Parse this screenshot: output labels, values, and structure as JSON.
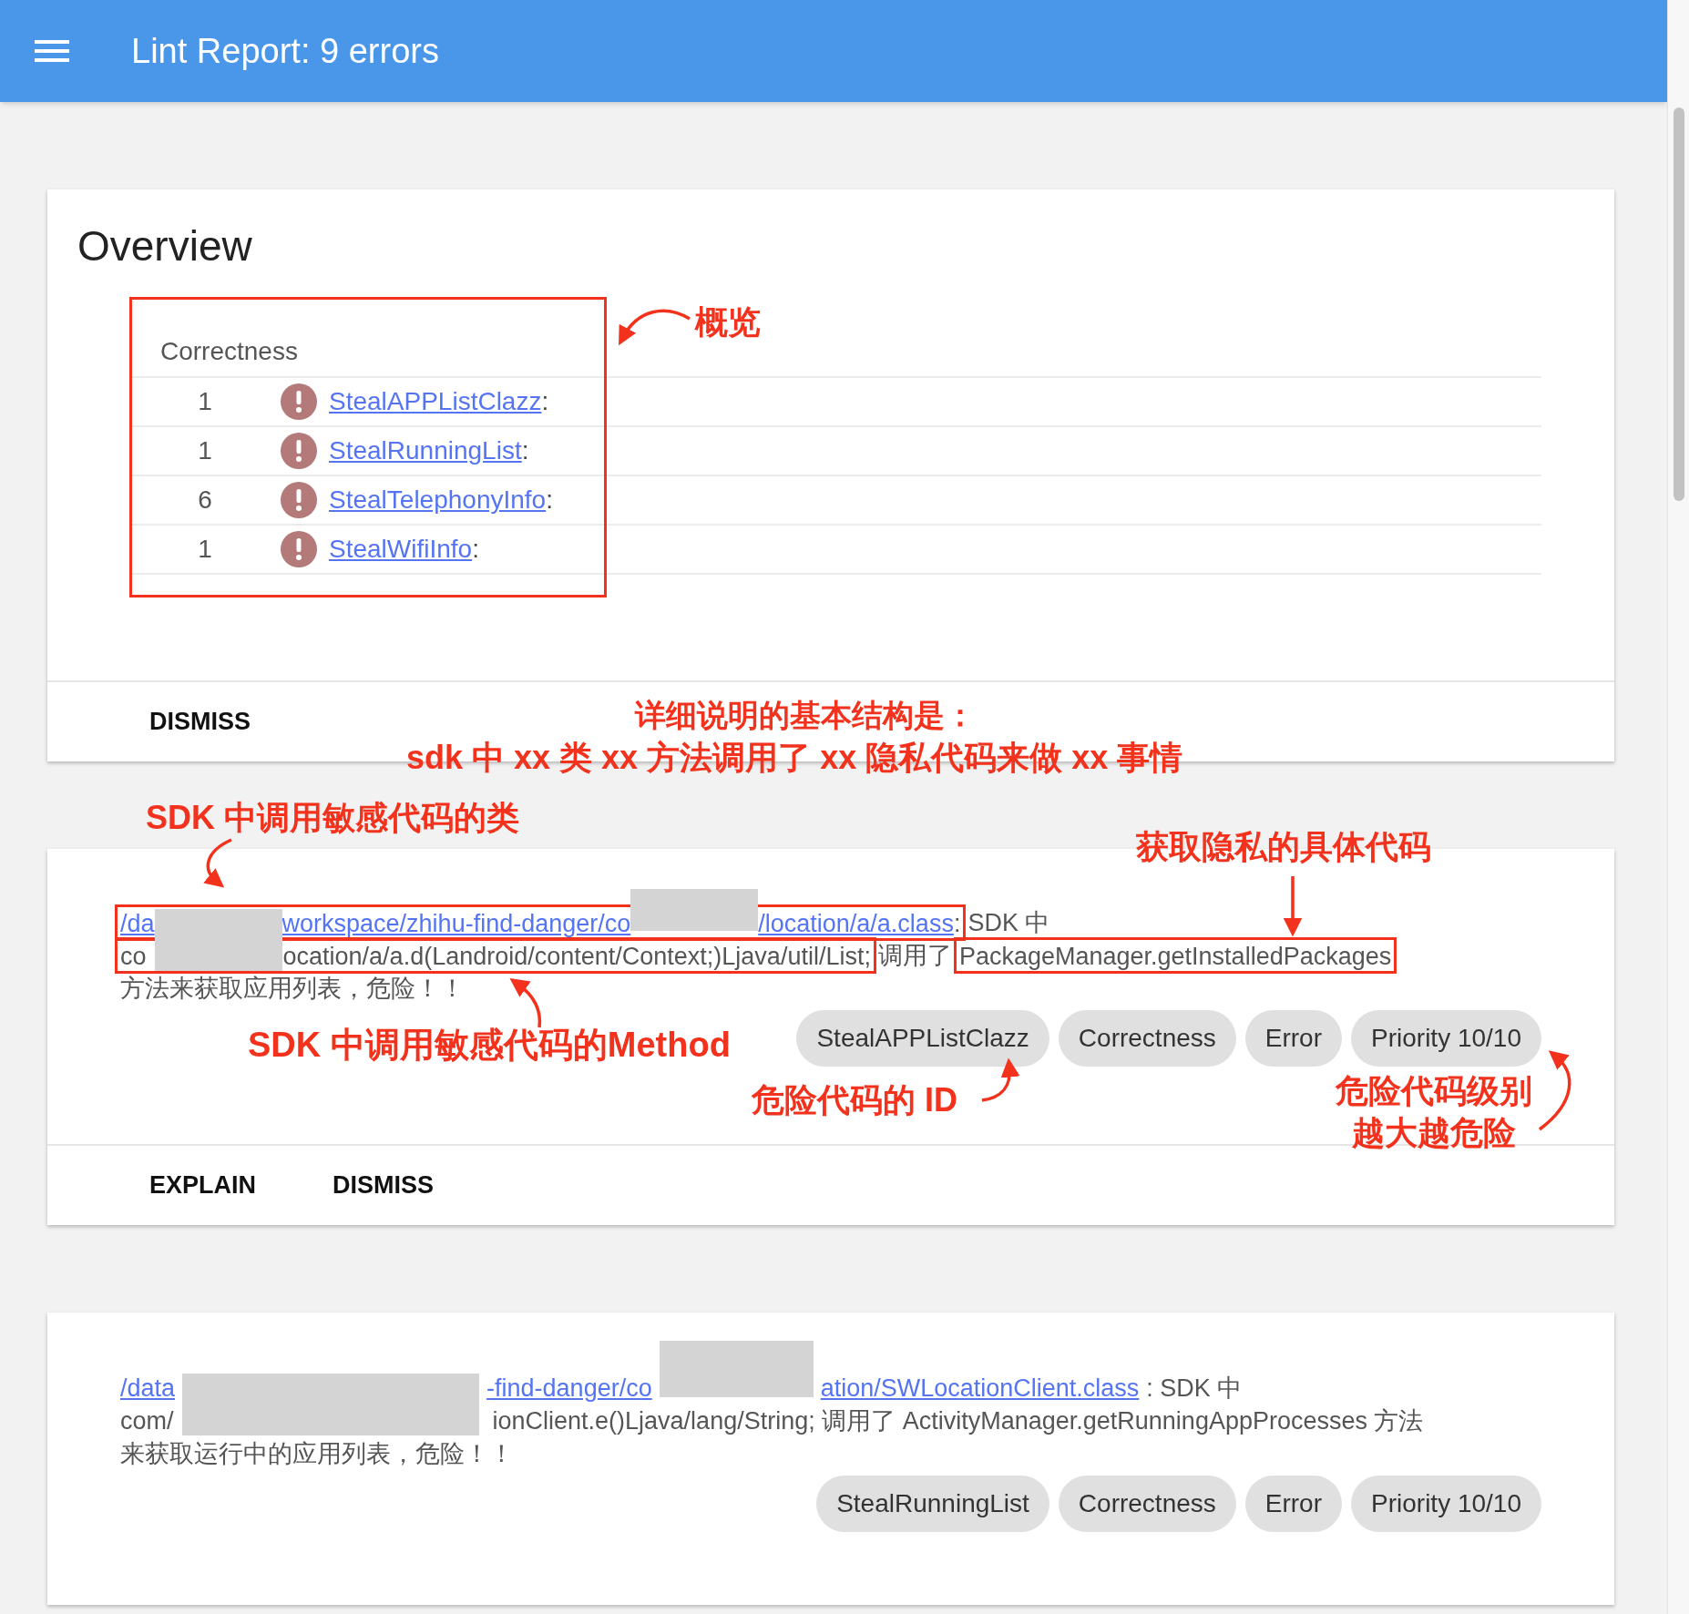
{
  "app_bar": {
    "title": "Lint Report: 9 errors"
  },
  "overview": {
    "title": "Overview",
    "category": "Correctness",
    "rows": [
      {
        "count": "1",
        "issue": "StealAPPListClazz",
        "suffix": ":"
      },
      {
        "count": "1",
        "issue": "StealRunningList",
        "suffix": ":"
      },
      {
        "count": "6",
        "issue": "StealTelephonyInfo",
        "suffix": ":"
      },
      {
        "count": "1",
        "issue": "StealWifiInfo",
        "suffix": ":"
      }
    ],
    "actions": [
      "DISMISS"
    ]
  },
  "issues": [
    {
      "lines": [
        [
          {
            "kind": "frame",
            "segments": [
              {
                "kind": "link",
                "text": "/da"
              },
              {
                "kind": "redaction"
              },
              {
                "kind": "link",
                "text": "workspace/zhihu-find-danger/co"
              },
              {
                "kind": "redaction"
              },
              {
                "kind": "link",
                "text": "/location/a/a.class"
              },
              {
                "kind": "text",
                "text": ":"
              }
            ]
          },
          {
            "kind": "text",
            "text": "SDK 中"
          }
        ],
        [
          {
            "kind": "frame",
            "segments": [
              {
                "kind": "text",
                "text": "co"
              },
              {
                "kind": "redaction"
              },
              {
                "kind": "text",
                "text": "ocation/a/a.d(Landroid/content/Context;)Ljava/util/List;"
              }
            ]
          },
          {
            "kind": "text",
            "text": "调用了"
          },
          {
            "kind": "frame",
            "segments": [
              {
                "kind": "text",
                "text": "PackageManager.getInstalledPackages"
              }
            ]
          }
        ],
        [
          {
            "kind": "text",
            "text": "方法来获取应用列表，危险！！"
          }
        ]
      ],
      "chips": [
        "StealAPPListClazz",
        "Correctness",
        "Error",
        "Priority 10/10"
      ],
      "actions": [
        "EXPLAIN",
        "DISMISS"
      ]
    },
    {
      "lines": [
        [
          {
            "kind": "link",
            "text": "/data"
          },
          {
            "kind": "redaction"
          },
          {
            "kind": "link",
            "text": "-find-danger/co"
          },
          {
            "kind": "redaction"
          },
          {
            "kind": "link",
            "text": "ation/SWLocationClient.class"
          },
          {
            "kind": "text",
            "text": ": SDK 中"
          }
        ],
        [
          {
            "kind": "text",
            "text": "com/"
          },
          {
            "kind": "redaction"
          },
          {
            "kind": "text",
            "text": "ionClient.e()Ljava/lang/String; 调用了 ActivityManager.getRunningAppProcesses 方法"
          }
        ],
        [
          {
            "kind": "text",
            "text": "来获取运行中的应用列表，危险！！"
          }
        ]
      ],
      "chips": [
        "StealRunningList",
        "Correctness",
        "Error",
        "Priority 10/10"
      ]
    }
  ],
  "annotations": [
    {
      "text": "概览"
    },
    {
      "text": "详细说明的基本结构是："
    },
    {
      "text": "sdk 中 xx 类 xx 方法调用了 xx 隐私代码来做 xx 事情"
    },
    {
      "text": "SDK 中调用敏感代码的类"
    },
    {
      "text": "获取隐私的具体代码"
    },
    {
      "text": "SDK 中调用敏感代码的Method"
    },
    {
      "text": "危险代码的 ID"
    },
    {
      "text": "危险代码级别"
    },
    {
      "text": "越大越危险"
    }
  ]
}
